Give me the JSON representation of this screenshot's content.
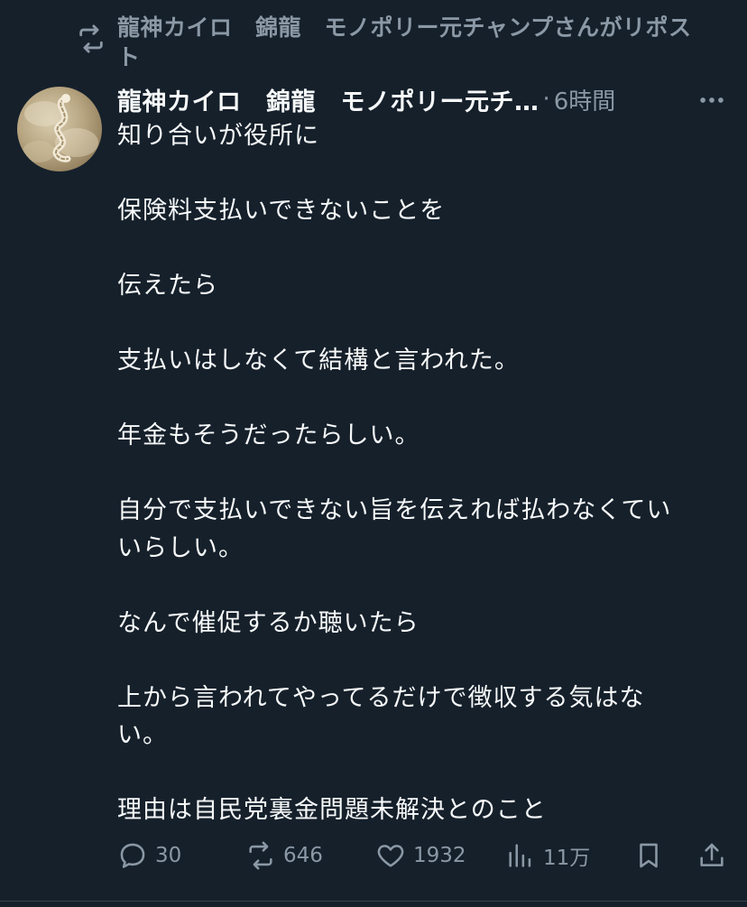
{
  "repost": {
    "icon": "repost-icon",
    "text": "龍神カイロ　錦龍　モノポリー元チャンプさんがリポスト"
  },
  "tweet": {
    "avatar": "dragon-avatar",
    "display_name": "龍神カイロ　錦龍　モノポリー元チ…",
    "separator": "·",
    "timestamp": "6時間",
    "more_icon": "more-icon",
    "body_lines": [
      "知り合いが役所に",
      "",
      "保険料支払いできないことを",
      "",
      "伝えたら",
      "",
      "支払いはしなくて結構と言われた。",
      "",
      "年金もそうだったらしい。",
      "",
      "自分で支払いできない旨を伝えれば払わなくてい\nいらしい。",
      "",
      "なんで催促するか聴いたら",
      "",
      "上から言われてやってるだけで徴収する気はな\nい。",
      "",
      "理由は自民党裏金問題未解決とのこと"
    ]
  },
  "actions": {
    "reply": {
      "icon": "reply-icon",
      "count": "30"
    },
    "repost": {
      "icon": "repost-icon",
      "count": "646"
    },
    "like": {
      "icon": "heart-icon",
      "count": "1932"
    },
    "views": {
      "icon": "views-icon",
      "count": "11万"
    },
    "bookmark": {
      "icon": "bookmark-icon"
    },
    "share": {
      "icon": "share-icon"
    }
  },
  "colors": {
    "background": "#15202b",
    "text": "#f7f9f9",
    "secondary": "#8b98a5"
  }
}
